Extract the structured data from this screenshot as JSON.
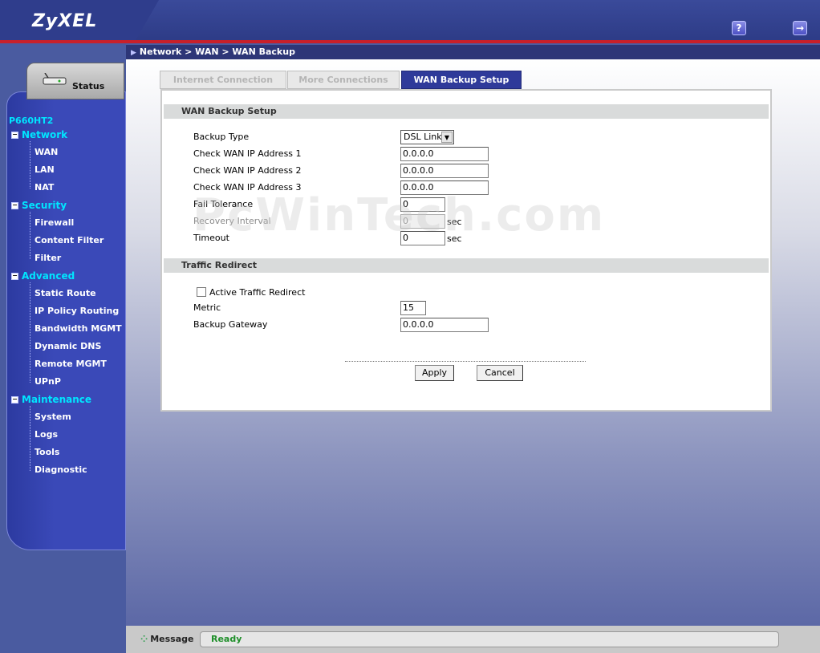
{
  "header": {
    "logo": "ZyXEL",
    "help_icon": "?",
    "logout_icon": "→"
  },
  "breadcrumb": "Network > WAN > WAN Backup",
  "sidebar": {
    "status_label": "Status",
    "model": "P660HT2",
    "sections": [
      {
        "label": "Network",
        "items": [
          "WAN",
          "LAN",
          "NAT"
        ]
      },
      {
        "label": "Security",
        "items": [
          "Firewall",
          "Content Filter",
          "Filter"
        ]
      },
      {
        "label": "Advanced",
        "items": [
          "Static Route",
          "IP Policy Routing",
          "Bandwidth MGMT",
          "Dynamic DNS",
          "Remote MGMT",
          "UPnP"
        ]
      },
      {
        "label": "Maintenance",
        "items": [
          "System",
          "Logs",
          "Tools",
          "Diagnostic"
        ]
      }
    ]
  },
  "tabs": {
    "internet": "Internet Connection",
    "more": "More Connections",
    "wan_backup": "WAN Backup Setup"
  },
  "wan_backup": {
    "section_title": "WAN Backup Setup",
    "backup_type_label": "Backup Type",
    "backup_type_value": "DSL Link",
    "check_ip1_label": "Check WAN IP Address  1",
    "check_ip1_value": "0.0.0.0",
    "check_ip2_label": "Check WAN IP Address  2",
    "check_ip2_value": "0.0.0.0",
    "check_ip3_label": "Check WAN IP Address  3",
    "check_ip3_value": "0.0.0.0",
    "fail_tolerance_label": "Fail Tolerance",
    "fail_tolerance_value": "0",
    "recovery_interval_label": "Recovery Interval",
    "recovery_interval_value": "0",
    "timeout_label": "Timeout",
    "timeout_value": "0",
    "sec_unit": "sec"
  },
  "traffic_redirect": {
    "section_title": "Traffic Redirect",
    "active_label": "Active Traffic Redirect",
    "active_checked": false,
    "metric_label": "Metric",
    "metric_value": "15",
    "gateway_label": "Backup Gateway",
    "gateway_value": "0.0.0.0"
  },
  "buttons": {
    "apply": "Apply",
    "cancel": "Cancel"
  },
  "watermark": "PcWinTech.com",
  "status_bar": {
    "label": "Message",
    "message": "Ready"
  }
}
